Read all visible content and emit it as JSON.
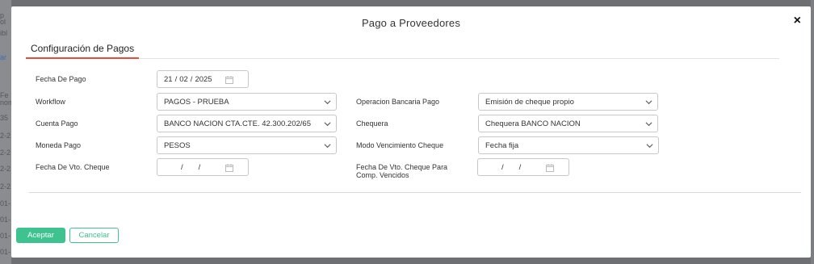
{
  "background": {
    "fragments": [
      "p",
      "ol",
      "ibl",
      "ar",
      "Fe",
      "nom",
      "35",
      "2-2",
      "2-2",
      "2-2",
      "2-2",
      "01-",
      "01-",
      "01-",
      "01-"
    ]
  },
  "modal": {
    "title": "Pago a Proveedores",
    "close_label": "×"
  },
  "tabs": [
    {
      "label": "Configuración de Pagos",
      "active": true
    }
  ],
  "form": {
    "fecha_pago": {
      "label": "Fecha De Pago",
      "day": "21",
      "month": "02",
      "year": "2025"
    },
    "workflow": {
      "label": "Workflow",
      "value": "PAGOS - PRUEBA"
    },
    "cuenta_pago": {
      "label": "Cuenta Pago",
      "value": "BANCO NACION CTA.CTE. 42.300.202/65"
    },
    "moneda_pago": {
      "label": "Moneda Pago",
      "value": "PESOS"
    },
    "fecha_vto_cheque": {
      "label": "Fecha De Vto. Cheque",
      "day": "",
      "month": "",
      "year": ""
    },
    "operacion_bancaria": {
      "label": "Operacion Bancaria Pago",
      "value": "Emisión de cheque propio"
    },
    "chequera": {
      "label": "Chequera",
      "value": "Chequera BANCO NACION"
    },
    "modo_vencimiento": {
      "label": "Modo Vencimiento Cheque",
      "value": "Fecha fija"
    },
    "fecha_vto_vencidos": {
      "label_line1": "Fecha De Vto. Cheque Para",
      "label_line2": "Comp. Vencidos",
      "day": "",
      "month": "",
      "year": ""
    }
  },
  "buttons": {
    "accept": "Aceptar",
    "cancel": "Cancelar"
  },
  "colors": {
    "primary": "#3ec28f",
    "tab_indicator": "#e74c3c",
    "overlay": "#6d6f73"
  },
  "icons": {
    "calendar": "calendar-icon",
    "chevron": "chevron-down-icon",
    "close": "close-icon"
  }
}
